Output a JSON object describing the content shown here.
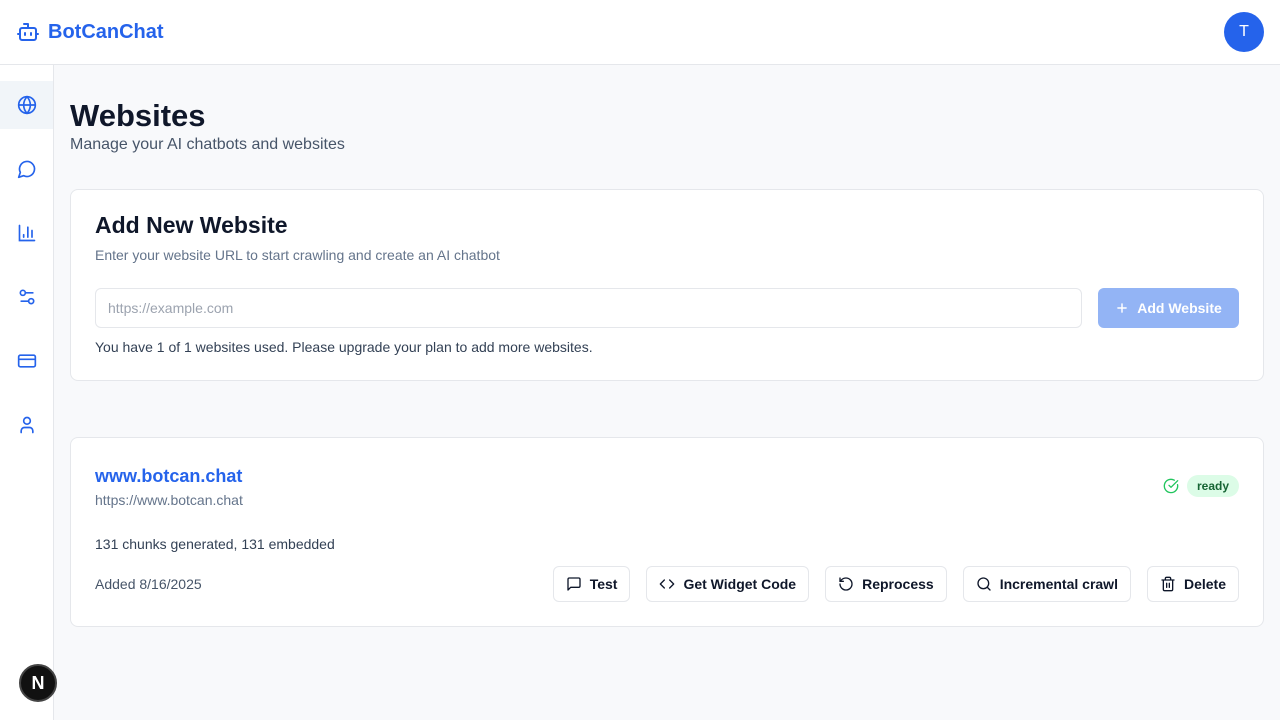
{
  "header": {
    "brand": "BotCanChat",
    "avatar_initial": "T"
  },
  "sidebar": {
    "items": [
      {
        "icon": "globe-icon",
        "active": true
      },
      {
        "icon": "chat-bubble-icon",
        "active": false
      },
      {
        "icon": "bar-chart-icon",
        "active": false
      },
      {
        "icon": "settings-sliders-icon",
        "active": false
      },
      {
        "icon": "credit-card-icon",
        "active": false
      },
      {
        "icon": "user-icon",
        "active": false
      }
    ],
    "dev_badge": "N"
  },
  "page": {
    "title": "Websites",
    "subtitle": "Manage your AI chatbots and websites"
  },
  "add_card": {
    "title": "Add New Website",
    "description": "Enter your website URL to start crawling and create an AI chatbot",
    "url_placeholder": "https://example.com",
    "url_value": "",
    "add_button": "Add Website",
    "usage_text": "You have 1 of 1 websites used. Please upgrade your plan to add more websites."
  },
  "website": {
    "name": "www.botcan.chat",
    "url": "https://www.botcan.chat",
    "status": "ready",
    "chunks_text": "131 chunks generated, 131 embedded",
    "added_text": "Added 8/16/2025",
    "actions": {
      "test": "Test",
      "widget": "Get Widget Code",
      "reprocess": "Reprocess",
      "crawl": "Incremental crawl",
      "delete": "Delete"
    }
  },
  "colors": {
    "accent": "#2563eb",
    "accent_disabled": "#93b4f5",
    "ready_bg": "#dcfce7",
    "ready_text": "#166534"
  }
}
